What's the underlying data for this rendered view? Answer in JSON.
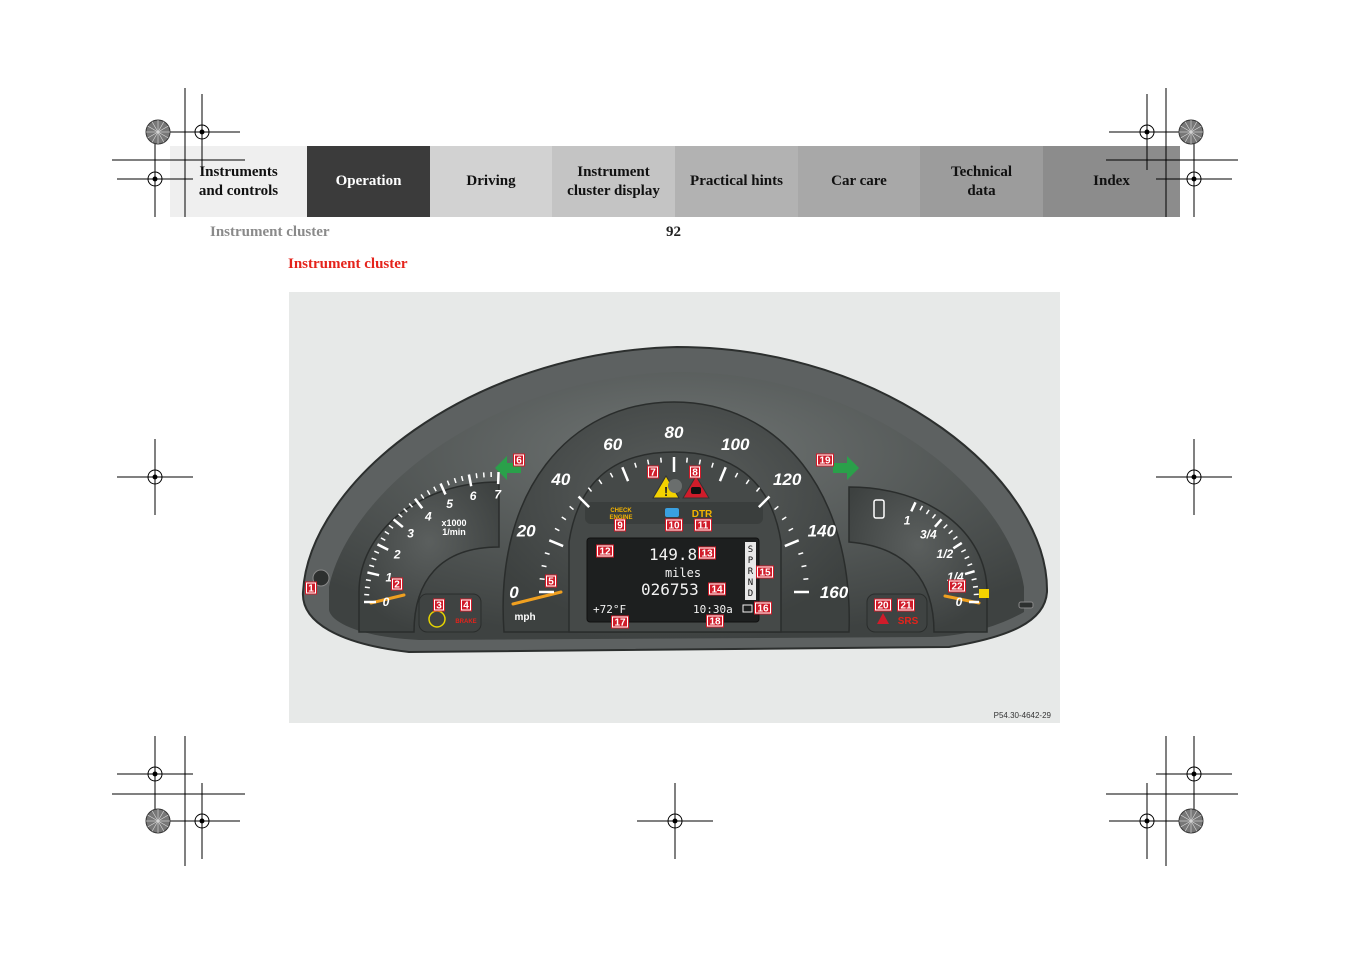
{
  "nav": {
    "tabs": [
      {
        "label": "Instruments\nand controls",
        "bg": "#efefef",
        "color": "#111111"
      },
      {
        "label": "Operation",
        "bg": "#3b3b3b",
        "color": "#ffffff"
      },
      {
        "label": "Driving",
        "bg": "#d2d2d2",
        "color": "#111111"
      },
      {
        "label": "Instrument\ncluster display",
        "bg": "#c4c4c4",
        "color": "#111111"
      },
      {
        "label": "Practical hints",
        "bg": "#b2b2b2",
        "color": "#111111"
      },
      {
        "label": "Car care",
        "bg": "#a8a8a8",
        "color": "#111111"
      },
      {
        "label": "Technical\ndata",
        "bg": "#9c9c9c",
        "color": "#111111"
      },
      {
        "label": "Index",
        "bg": "#8c8c8c",
        "color": "#111111"
      }
    ]
  },
  "header": {
    "running_head": "Instrument cluster",
    "page_number": "92"
  },
  "section": {
    "title": "Instrument cluster"
  },
  "figure": {
    "code": "P54.30-4642-29",
    "tach": {
      "ticks": [
        "0",
        "1",
        "2",
        "3",
        "4",
        "5",
        "6",
        "7"
      ],
      "unit_line1": "x1000",
      "unit_line2": "1/min"
    },
    "speedo": {
      "ticks": [
        "0",
        "20",
        "40",
        "60",
        "80",
        "100",
        "120",
        "140",
        "160"
      ],
      "unit": "mph"
    },
    "fuel": {
      "ticks": [
        "0",
        "1/4",
        "1/2",
        "3/4",
        "1"
      ]
    },
    "lamps": {
      "check_engine_line1": "CHECK",
      "check_engine_line2": "ENGINE",
      "dtr": "DTR",
      "srs": "SRS",
      "brake": "BRAKE"
    },
    "display": {
      "trip": "149.8",
      "unit": "miles",
      "odometer": "026753",
      "temperature": "+72°F",
      "clock": "10:30a",
      "gear_letters": [
        "S",
        "P",
        "R",
        "N",
        "D"
      ]
    },
    "callouts": [
      "1",
      "2",
      "3",
      "4",
      "5",
      "6",
      "7",
      "8",
      "9",
      "10",
      "11",
      "12",
      "13",
      "14",
      "15",
      "16",
      "17",
      "18",
      "19",
      "20",
      "21",
      "22"
    ]
  },
  "colors": {
    "accent_red": "#e5231b",
    "callout_red": "#d01c2a",
    "needle": "#f0a020",
    "arrow_green": "#2aa04a"
  }
}
